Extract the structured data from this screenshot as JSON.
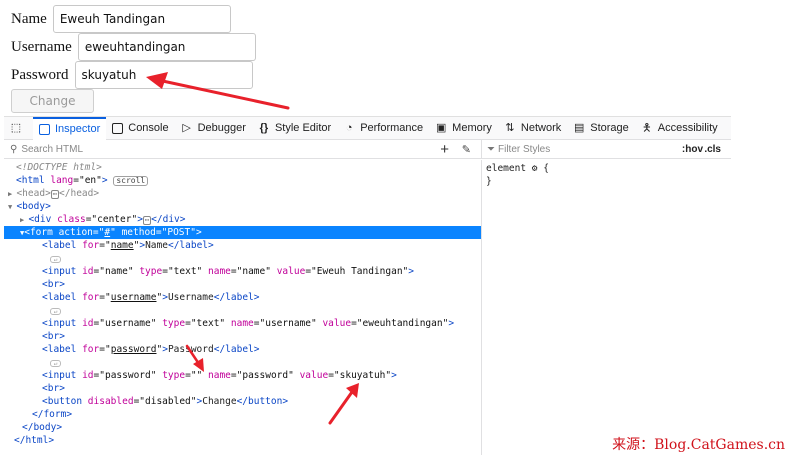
{
  "form": {
    "name_label": "Name",
    "name_value": "Eweuh Tandingan",
    "username_label": "Username",
    "username_value": "eweuhtandingan",
    "password_label": "Password",
    "password_value": "skuyatuh",
    "change_button": "Change"
  },
  "devtools": {
    "tabs": [
      {
        "label": "Inspector",
        "icon": "inspector-icon",
        "active": true
      },
      {
        "label": "Console",
        "icon": "console-icon"
      },
      {
        "label": "Debugger",
        "icon": "debugger-icon"
      },
      {
        "label": "Style Editor",
        "icon": "style-editor-icon"
      },
      {
        "label": "Performance",
        "icon": "performance-icon"
      },
      {
        "label": "Memory",
        "icon": "memory-icon"
      },
      {
        "label": "Network",
        "icon": "network-icon"
      },
      {
        "label": "Storage",
        "icon": "storage-icon"
      },
      {
        "label": "Accessibility",
        "icon": "accessibility-icon"
      }
    ],
    "search_placeholder": "Search HTML",
    "filter_placeholder": "Filter Styles",
    "hov": ":hov",
    "cls": ".cls",
    "rules_line1": "element ",
    "rules_brace_open": " {",
    "rules_brace_close": "}",
    "markup": {
      "doctype": "<!DOCTYPE html>",
      "scroll_badge": "scroll",
      "ellipsis": "⋯",
      "ws": "↵",
      "tag_html": "html",
      "attr_lang": "lang",
      "val_lang": "\"en\"",
      "tag_head": "head",
      "tag_body": "body",
      "tag_div": "div",
      "attr_class": "class",
      "val_center": "\"center\"",
      "tag_form": "form",
      "attr_action": "action",
      "val_action_q1": "\"",
      "val_action_hash": "#",
      "val_action_q2": "\"",
      "attr_method": "method",
      "val_method": "\"POST\"",
      "tag_label": "label",
      "attr_for": "for",
      "val_for_name": "name",
      "text_name": "Name",
      "tag_input": "input",
      "attr_id": "id",
      "attr_type": "type",
      "attr_name": "name",
      "attr_value": "value",
      "val_id_name": "\"name\"",
      "val_type_text": "\"text\"",
      "val_name_name": "\"name\"",
      "val_value_name": "\"Eweuh Tandingan\"",
      "tag_br": "br",
      "val_for_username": "username",
      "text_username": "Username",
      "val_id_username": "\"username\"",
      "val_name_username": "\"username\"",
      "val_value_username": "\"eweuhtandingan\"",
      "val_for_password": "password",
      "text_password": "Password",
      "val_id_password": "\"password\"",
      "val_type_empty": "\"\"",
      "val_name_password": "\"password\"",
      "val_value_password": "\"skuyatuh\"",
      "tag_button": "button",
      "attr_disabled": "disabled",
      "val_disabled": "\"disabled\"",
      "text_change": "Change"
    }
  },
  "watermark": "来源：Blog.CatGames.cn",
  "colors": {
    "accent": "#0a84ff",
    "tag": "#0b46c6",
    "attr": "#c00099",
    "arrow": "#e8212b"
  }
}
